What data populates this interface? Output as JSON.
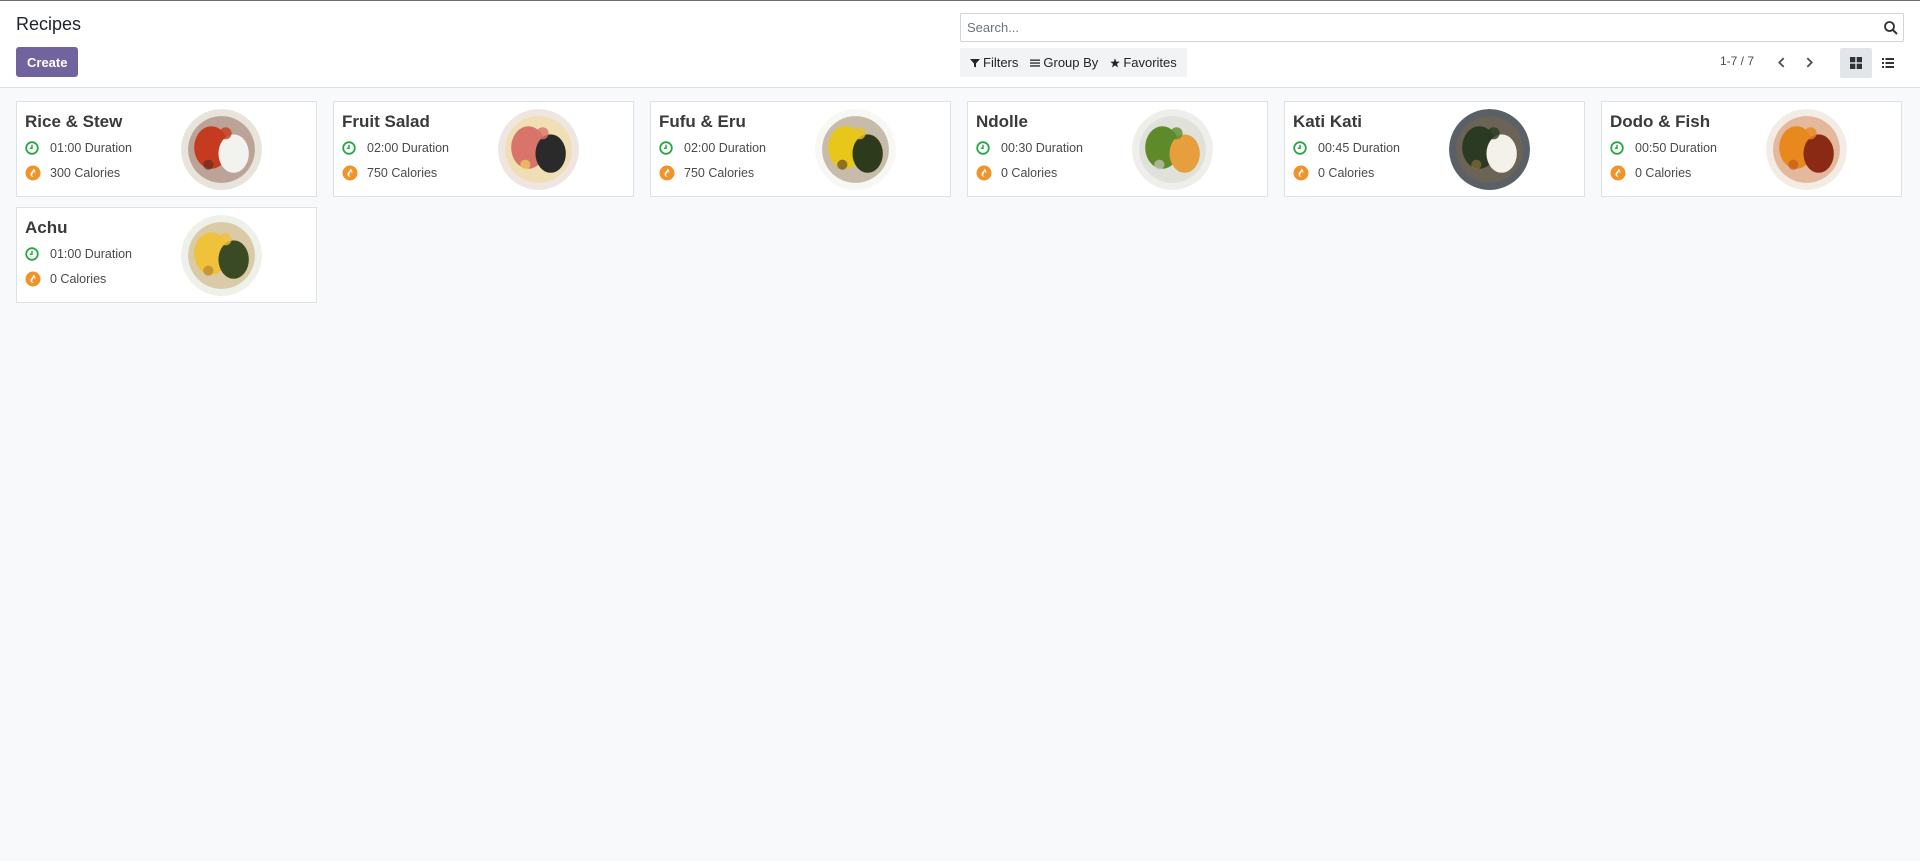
{
  "header": {
    "title": "Recipes",
    "create_label": "Create"
  },
  "search": {
    "placeholder": "Search..."
  },
  "filters": {
    "filters_label": "Filters",
    "group_by_label": "Group By",
    "favorites_label": "Favorites"
  },
  "pager": {
    "text": "1-7 / 7"
  },
  "icons": {
    "search": "search-icon",
    "filter": "filter-icon",
    "group_by": "bars-icon",
    "favorites": "star-icon",
    "prev": "chevron-left-icon",
    "next": "chevron-right-icon",
    "kanban_view": "th-large-icon",
    "list_view": "list-icon",
    "duration": "clock-icon",
    "calories": "fire-icon"
  },
  "colors": {
    "primary": "#71639e",
    "duration_icon": "#28a745",
    "calories_icon": "#f0932b"
  },
  "recipes": [
    {
      "name": "Rice & Stew",
      "duration": "01:00 Duration",
      "calories": "300 Calories",
      "dish": [
        "#e8e4dc",
        "#c63a1f",
        "#f2f2ee",
        "#6a2c18"
      ]
    },
    {
      "name": "Fruit Salad",
      "duration": "02:00 Duration",
      "calories": "750 Calories",
      "dish": [
        "#efe6e2",
        "#d8746a",
        "#2a2a2a",
        "#f4d061"
      ]
    },
    {
      "name": "Fufu & Eru",
      "duration": "02:00 Duration",
      "calories": "750 Calories",
      "dish": [
        "#f7f7f4",
        "#e8c61a",
        "#2e3a1c",
        "#6c4a1e"
      ]
    },
    {
      "name": "Ndolle",
      "duration": "00:30 Duration",
      "calories": "0 Calories",
      "dish": [
        "#eeeeea",
        "#5e8a2a",
        "#e69f3c",
        "#c9c9c2"
      ]
    },
    {
      "name": "Kati Kati",
      "duration": "00:45 Duration",
      "calories": "0 Calories",
      "dish": [
        "#5a6066",
        "#2b3a22",
        "#f4f1ea",
        "#8b6b3a"
      ]
    },
    {
      "name": "Dodo & Fish",
      "duration": "00:50 Duration",
      "calories": "0 Calories",
      "dish": [
        "#f3ece4",
        "#e8891e",
        "#8b2a14",
        "#c55a1a"
      ]
    },
    {
      "name": "Achu",
      "duration": "01:00 Duration",
      "calories": "0 Calories",
      "dish": [
        "#eef0ea",
        "#f0c13a",
        "#3a4a22",
        "#b7852e"
      ]
    }
  ]
}
